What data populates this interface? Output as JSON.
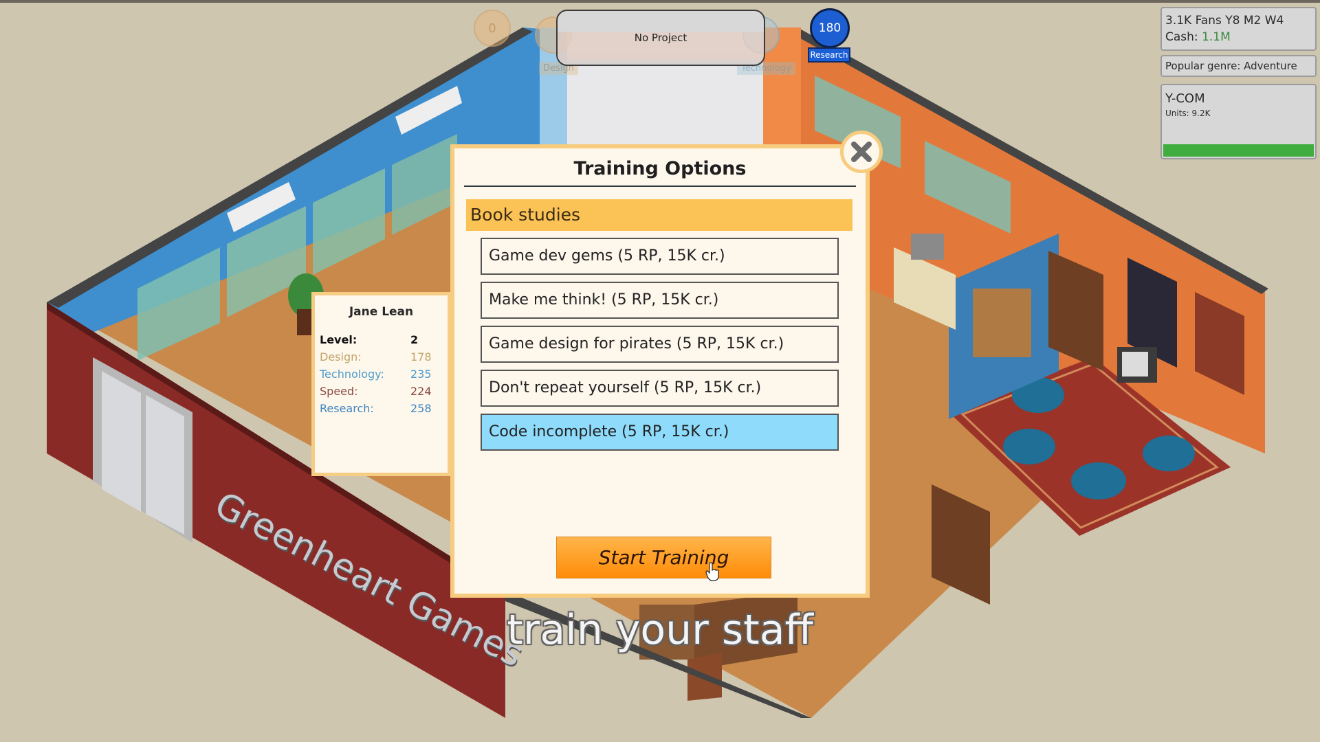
{
  "hud": {
    "design_points": "0",
    "design_label": "Design",
    "technology_label": "Technology",
    "project_status": "No Project",
    "research_points": "180",
    "research_label": "Research"
  },
  "info": {
    "fans_date": "3.1K Fans Y8 M2 W4",
    "cash_label": "Cash:",
    "cash_value": "1.1M",
    "popular_genre": "Popular genre: Adventure",
    "console_name": "Y-COM",
    "console_units": "Units: 9.2K",
    "console_market_progress": 1.0
  },
  "staff": {
    "name": "Jane Lean",
    "stats": [
      {
        "label": "Level:",
        "value": "2"
      },
      {
        "label": "Design:",
        "value": "178"
      },
      {
        "label": "Technology:",
        "value": "235"
      },
      {
        "label": "Speed:",
        "value": "224"
      },
      {
        "label": "Research:",
        "value": "258"
      }
    ]
  },
  "modal": {
    "title": "Training Options",
    "category": "Book studies",
    "options": [
      {
        "label": "Game dev gems (5 RP, 15K cr.)",
        "selected": false
      },
      {
        "label": "Make me think! (5 RP, 15K cr.)",
        "selected": false
      },
      {
        "label": "Game design for pirates (5 RP, 15K cr.)",
        "selected": false
      },
      {
        "label": "Don't repeat yourself (5 RP, 15K cr.)",
        "selected": false
      },
      {
        "label": "Code incomplete (5 RP, 15K cr.)",
        "selected": true
      }
    ],
    "start_button": "Start Training"
  },
  "scene": {
    "company_sign": "Greenheart Games",
    "subtitle": "train your staff"
  },
  "colors": {
    "accent_orange": "#ff8c08",
    "category_yellow": "#fbc356",
    "selected_blue": "#8fdbfb",
    "research_blue": "#1d5fd2",
    "cash_green": "#3c8a3c"
  }
}
